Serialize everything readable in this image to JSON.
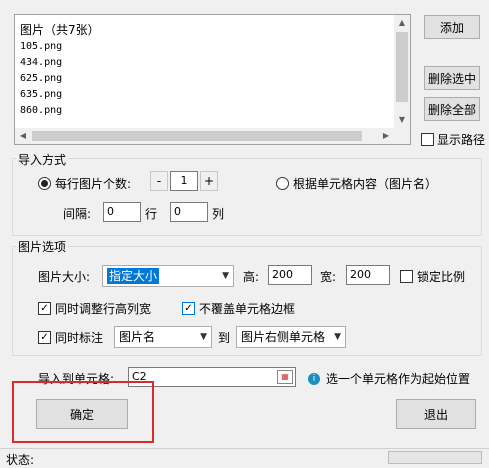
{
  "image_list": {
    "header": "图片（共7张）",
    "items": [
      "105.png",
      "434.png",
      "625.png",
      "635.png",
      "860.png"
    ]
  },
  "side_buttons": {
    "add": "添加",
    "delete_selected": "删除选中",
    "delete_all": "删除全部",
    "show_path": "显示路径"
  },
  "import_mode": {
    "title": "导入方式",
    "per_row_label": "每行图片个数:",
    "minus": "-",
    "per_row_value": "1",
    "plus": "+",
    "by_cell_label": "根据单元格内容（图片名）",
    "gap_label": "间隔:",
    "row_gap": "0",
    "row_unit": "行",
    "col_gap": "0",
    "col_unit": "列"
  },
  "image_options": {
    "title": "图片选项",
    "size_label": "图片大小:",
    "size_value": "指定大小",
    "height_label": "高:",
    "height_value": "200",
    "width_label": "宽:",
    "width_value": "200",
    "lock_ratio": "锁定比例",
    "adjust_rowcol": "同时调整行高列宽",
    "no_cover_border": "不覆盖单元格边框",
    "annotate": "同时标注",
    "annotate_value": "图片名",
    "to": "到",
    "annotate_target": "图片右侧单元格"
  },
  "target": {
    "label": "导入到单元格:",
    "value": "C2",
    "hint": "选一个单元格作为起始位置"
  },
  "actions": {
    "confirm": "确定",
    "exit": "退出"
  },
  "status": {
    "label": "状态:"
  },
  "colors": {
    "highlight": "#d92b2b",
    "select_blue": "#0078d7",
    "info": "#1a8fbf"
  }
}
